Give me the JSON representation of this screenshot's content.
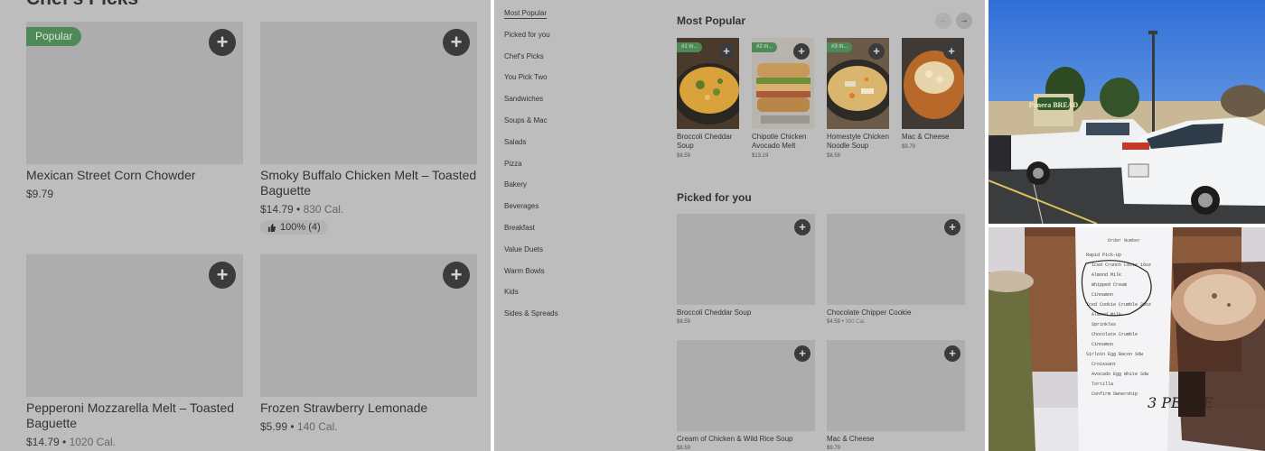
{
  "panel1": {
    "section_title": "Chef's Picks",
    "cards": [
      {
        "name": "Mexican Street Corn Chowder",
        "price": "$9.79",
        "calories": "",
        "badge": "Popular",
        "rating": ""
      },
      {
        "name": "Smoky Buffalo Chicken Melt – Toasted Baguette",
        "price": "$14.79",
        "calories": "830 Cal.",
        "badge": "",
        "rating": "100% (4)"
      },
      {
        "name": "Pepperoni Mozzarella Melt – Toasted Baguette",
        "price": "$14.79",
        "calories": "1020 Cal.",
        "badge": "",
        "rating": ""
      },
      {
        "name": "Frozen Strawberry Lemonade",
        "price": "$5.99",
        "calories": "140 Cal.",
        "badge": "",
        "rating": ""
      }
    ]
  },
  "panel2": {
    "nav": [
      "Most Popular",
      "Picked for you",
      "Chef's Picks",
      "You Pick Two",
      "Sandwiches",
      "Soups & Mac",
      "Salads",
      "Pizza",
      "Bakery",
      "Beverages",
      "Breakfast",
      "Value Duets",
      "Warm Bowls",
      "Kids",
      "Sides & Spreads"
    ],
    "most_popular_title": "Most Popular",
    "picked_title": "Picked for you",
    "most_popular": [
      {
        "rank": "#1 m...",
        "name": "Broccoli Cheddar Soup",
        "price": "$8.59"
      },
      {
        "rank": "#2 m...",
        "name": "Chipotle Chicken Avocado Melt",
        "price": "$13.19"
      },
      {
        "rank": "#3 m...",
        "name": "Homestyle Chicken Noodle Soup",
        "price": "$8.59"
      },
      {
        "rank": "",
        "name": "Mac & Cheese",
        "price": "$9.79"
      }
    ],
    "picked": [
      {
        "name": "Broccoli Cheddar Soup",
        "price": "$8.59",
        "calories": ""
      },
      {
        "name": "Chocolate Chipper Cookie",
        "price": "$4.59",
        "calories": "390 Cal."
      },
      {
        "name": "Cream of Chicken & Wild Rice Soup",
        "price": "$8.59",
        "calories": ""
      },
      {
        "name": "Mac & Cheese",
        "price": "$9.79",
        "calories": ""
      }
    ]
  },
  "photo1": {
    "sign": "Panera BREAD"
  },
  "photo2": {
    "receipt_header": "Order Number",
    "receipt_lines": [
      "Rapid Pick-Up",
      "Iced Crunch Latte 16oz",
      "Almond Milk",
      "Whipped Cream",
      "Cinnamon",
      "Iced Cookie Crumble 20oz",
      "Almond Milk",
      "Sprinkles",
      "Chocolate Crumble",
      "Cinnamon",
      "Sirloin Egg Bacon Sdw",
      "Croissant",
      "Avocado Egg White Sdw",
      "Tortilla",
      "Confirm Ownership"
    ],
    "signature": "3 PEACE"
  },
  "colors": {
    "panel_bg": "#bdbdbd",
    "placeholder": "#adadad",
    "badge_green": "#4d8a57",
    "plus_button": "#3b3b3b"
  }
}
